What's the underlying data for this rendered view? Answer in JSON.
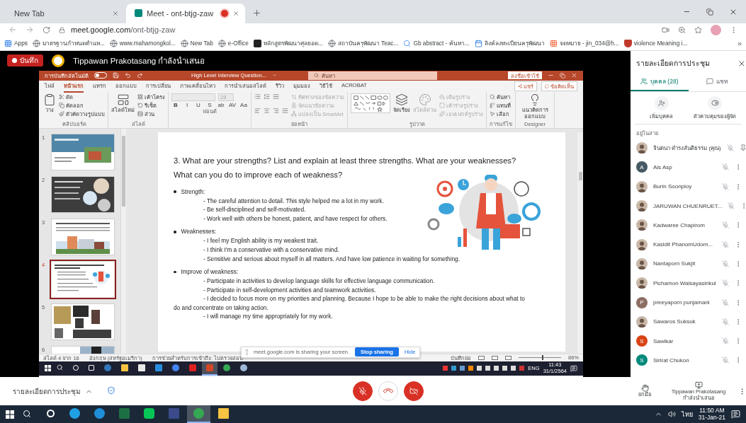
{
  "browser": {
    "tabs": [
      {
        "title": "New Tab",
        "selected": false,
        "recording": false
      },
      {
        "title": "Meet - ont-btjg-zaw",
        "selected": true,
        "recording": true
      }
    ],
    "address": {
      "host": "meet.google.com",
      "path": "/ont-btjg-zaw"
    },
    "bookmarks": [
      {
        "label": "Apps",
        "kind": "apps"
      },
      {
        "label": "มาตรฐานกำหนดตำแห...",
        "kind": "globe"
      },
      {
        "label": "www.mahamongkol...",
        "kind": "globe"
      },
      {
        "label": "New Tab",
        "kind": "globe"
      },
      {
        "label": "e-Office",
        "kind": "globe"
      },
      {
        "label": "หลักสูตรพัฒนาศุลยอด...",
        "kind": "app"
      },
      {
        "label": "สถาบันครุพัฒนา Teac...",
        "kind": "globe"
      },
      {
        "label": "Gb abstract - ค้นหา...",
        "kind": "google"
      },
      {
        "label": "ลิงค์ลงทะเบียนครุพัฒนา",
        "kind": "calendar"
      },
      {
        "label": "จดหมาย - jin_034@h...",
        "kind": "tiles"
      },
      {
        "label": "violence Meaning i...",
        "kind": "crest"
      }
    ],
    "overflow": "»"
  },
  "meet": {
    "record": "บันทึก",
    "presenter": "Tippawan Prakotasang กำลังนำเสนอ"
  },
  "powerpoint": {
    "autosave": {
      "label": "การบันทึกอัตโนมัติ",
      "on": false
    },
    "filename": "High Level Interview Question...",
    "search_placeholder": "ค้นหา",
    "signin": "ลงชื่อเข้าใช้",
    "ribbon_tabs": [
      {
        "label": "ไฟล์",
        "selected": false
      },
      {
        "label": "หน้าแรก",
        "selected": true
      },
      {
        "label": "แทรก",
        "selected": false
      },
      {
        "label": "ออกแบบ",
        "selected": false
      },
      {
        "label": "การเปลี่ยน",
        "selected": false
      },
      {
        "label": "ภาพเคลื่อนไหว",
        "selected": false
      },
      {
        "label": "การนำเสนอสไลด์",
        "selected": false
      },
      {
        "label": "รีวิว",
        "selected": false
      },
      {
        "label": "มุมมอง",
        "selected": false
      },
      {
        "label": "วิธีใช้",
        "selected": false
      },
      {
        "label": "ACROBAT",
        "selected": false
      }
    ],
    "share": "แชร์",
    "comments": "ข้อคิดเห็น",
    "ribbon_groups": [
      {
        "label": "คลิปบอร์ด",
        "kind": "tools",
        "large_items": [
          {
            "kind": "paste",
            "label": "วาง",
            "disabled": false
          }
        ],
        "small_items": [
          {
            "kind": "cut",
            "label": "ตัด",
            "disabled": false
          },
          {
            "kind": "copy",
            "label": "คัดลอก",
            "disabled": false
          },
          {
            "kind": "format",
            "label": "ตัวคัดวางรูปแบบ",
            "disabled": false
          }
        ]
      },
      {
        "label": "สไลด์",
        "kind": "tools",
        "large_items": [
          {
            "kind": "new_slide",
            "label": "สไลด์ใหม่",
            "disabled": false
          }
        ],
        "small_items": [
          {
            "kind": "layout",
            "label": "เค้าโครง",
            "disabled": false
          },
          {
            "kind": "reset",
            "label": "รีเซ็ต",
            "disabled": false
          },
          {
            "kind": "section",
            "label": "ส่วน",
            "disabled": false
          }
        ]
      },
      {
        "label": "ฟอนต์",
        "kind": "font",
        "font_size": "28",
        "buttons": [
          "B",
          "I",
          "U",
          "S",
          "ab",
          "AV",
          "Aa"
        ]
      },
      {
        "label": "ย่อหน้า",
        "kind": "paragraph",
        "small_items": [
          {
            "kind": "text_direction",
            "label": "ทิศทางของข้อความ",
            "disabled": true
          },
          {
            "kind": "align_text",
            "label": "จัดแนวข้อความ",
            "disabled": true
          },
          {
            "kind": "smartart",
            "label": "แปลงเป็น SmartArt",
            "disabled": true
          }
        ]
      },
      {
        "label": "รูปวาด",
        "kind": "drawing",
        "large_items": [
          {
            "kind": "arrange",
            "label": "จัดเรียง",
            "disabled": false
          },
          {
            "kind": "quick_styles",
            "label": "สไตล์ด่วน",
            "disabled": true
          }
        ],
        "small_items": [
          {
            "kind": "fill",
            "label": "เติมรูปร่าง",
            "disabled": true
          },
          {
            "kind": "outline",
            "label": "เค้าร่างรูปร่าง",
            "disabled": true
          },
          {
            "kind": "effects",
            "label": "เอฟเฟกต์รูปร่าง",
            "disabled": true
          }
        ]
      },
      {
        "label": "การแก้ไข",
        "kind": "tools",
        "small_items": [
          {
            "kind": "find",
            "label": "ค้นหา",
            "disabled": false
          },
          {
            "kind": "replace",
            "label": "แทนที่",
            "disabled": false
          },
          {
            "kind": "select",
            "label": "เลือก",
            "disabled": false
          }
        ]
      },
      {
        "label": "Designer",
        "kind": "tools",
        "large_items": [
          {
            "kind": "designer",
            "label": "แนวคิดการออกแบบ",
            "disabled": false
          }
        ]
      }
    ],
    "thumbnails": [
      {
        "number": "1",
        "kind": "title",
        "selected": false
      },
      {
        "number": "2",
        "kind": "dark",
        "selected": false
      },
      {
        "number": "3",
        "kind": "building",
        "selected": false
      },
      {
        "number": "4",
        "kind": "text",
        "selected": true
      },
      {
        "number": "5",
        "kind": "collage",
        "selected": false
      },
      {
        "number": "6",
        "kind": "photo",
        "selected": false
      }
    ],
    "slide": {
      "title": "3. What are your strengths? List and explain at least three strengths. What are your weaknesses? What can you do to improve each of weakness?",
      "sections": [
        {
          "heading": "Strength:",
          "items": [
            "- The careful attention to detail. This style helped me a lot in my work.",
            "- Be self-disciplined and self-motivated.",
            "- Work well with others be honest, patient, and have respect for others."
          ]
        },
        {
          "heading": "Weaknesses:",
          "items": [
            "- I feel my English ability is my weakest trait.",
            "- I think I'm a conservative with a conservative mind.",
            "- Sensitive and serious about myself in all matters. And have low patience in waiting for something."
          ]
        },
        {
          "heading": "Improve of weakness:",
          "items": [
            "- Participate in activities to develop language skills for effective language communication.",
            "- Participate in self-development activities and teamwork activities.",
            "- I decided to focus more on my priorities and planning. Because I hope to be able to make the right decisions about what to do and concentrate on taking action.",
            "- I will manage my time appropriately for my work."
          ]
        }
      ]
    },
    "status": {
      "slide": "สไลด์ 4 จาก 16",
      "language": "อังกฤษ (สหรัฐอเมริกา)",
      "accessibility": "การช่วยสำหรับการเข้าถึง: ไปตรวจสอบ",
      "notes": "บันทึกย่อ",
      "zoom_slider": {
        "level": 0.55
      },
      "zoom": "86%"
    }
  },
  "sharing_notice": {
    "text": "meet.google.com is sharing your screen.",
    "stop": "Stop sharing",
    "hide": "Hide"
  },
  "remote_taskbar": {
    "apps": [
      {
        "kind": "edge_old",
        "active": false
      },
      {
        "kind": "folder",
        "active": false
      },
      {
        "kind": "store",
        "active": false
      },
      {
        "kind": "mail",
        "active": false
      },
      {
        "kind": "chrome_alt",
        "active": false
      },
      {
        "kind": "acrobat",
        "active": false
      },
      {
        "kind": "powerpoint",
        "active": true
      },
      {
        "kind": "chrome",
        "active": false
      },
      {
        "kind": "paint",
        "active": false
      }
    ],
    "language": "ENG",
    "time": "11:43",
    "date": "31/1/2564"
  },
  "panel": {
    "title": "รายละเอียดการประชุม",
    "tabs": [
      {
        "label": "บุคคล (28)",
        "kind": "people",
        "selected": true
      },
      {
        "label": "แชท",
        "kind": "chat",
        "selected": false
      }
    ],
    "actions": [
      {
        "label": "เพิ่มบุคคล",
        "kind": "add"
      },
      {
        "label": "ตัวควบคุมของผู้จัด",
        "kind": "host"
      }
    ],
    "section": "อยู่ในสาย",
    "participants": [
      {
        "name": "จินตนา ดำรงสันติธรรม (คุณ)",
        "kind": "photo",
        "muted": true,
        "self": true
      },
      {
        "name": "Ais Asp",
        "kind": "letter",
        "letter": "A",
        "color": "#455a64",
        "muted": true,
        "self": false
      },
      {
        "name": "Burin Soonploy",
        "kind": "photo",
        "muted": true,
        "self": false
      },
      {
        "name": "JARUWAN CHUENRUET...",
        "kind": "photo",
        "muted": true,
        "self": false
      },
      {
        "name": "Kadwaree Chapirom",
        "kind": "photo",
        "muted": true,
        "self": false
      },
      {
        "name": "Kasidit PhanomUdom...",
        "kind": "photo",
        "muted": true,
        "self": false
      },
      {
        "name": "Nantaporn Sukjit",
        "kind": "photo",
        "muted": true,
        "self": false
      },
      {
        "name": "Pichamon Waisayasirikul",
        "kind": "photo",
        "muted": true,
        "self": false
      },
      {
        "name": "preeyaporn punjamani",
        "kind": "letter",
        "letter": "P",
        "color": "#8d6e63",
        "muted": true,
        "self": false
      },
      {
        "name": "Sawaros Suksuk",
        "kind": "photo",
        "muted": true,
        "self": false
      },
      {
        "name": "Sawikar",
        "kind": "letter",
        "letter": "S",
        "color": "#d84315",
        "muted": true,
        "self": false
      },
      {
        "name": "Sirirat Chukon",
        "kind": "letter",
        "letter": "S",
        "color": "#00897b",
        "muted": true,
        "self": false
      }
    ]
  },
  "controls": {
    "details": "รายละเอียดการประชุม",
    "mic_on": false,
    "camera_on": false,
    "raise_hand": "ยกมือ",
    "presenting": "Tippawan Prakotasang กำลังนำเสนอ"
  },
  "taskbar": {
    "apps": [
      {
        "kind": "ie",
        "active": false
      },
      {
        "kind": "edge",
        "active": false
      },
      {
        "kind": "excel",
        "active": false
      },
      {
        "kind": "line",
        "active": false
      },
      {
        "kind": "tool",
        "active": false
      },
      {
        "kind": "chrome",
        "active": true
      },
      {
        "kind": "folder",
        "active": false
      }
    ],
    "language": "ไทย",
    "time": "11:50 AM",
    "date": "31-Jan-21"
  }
}
